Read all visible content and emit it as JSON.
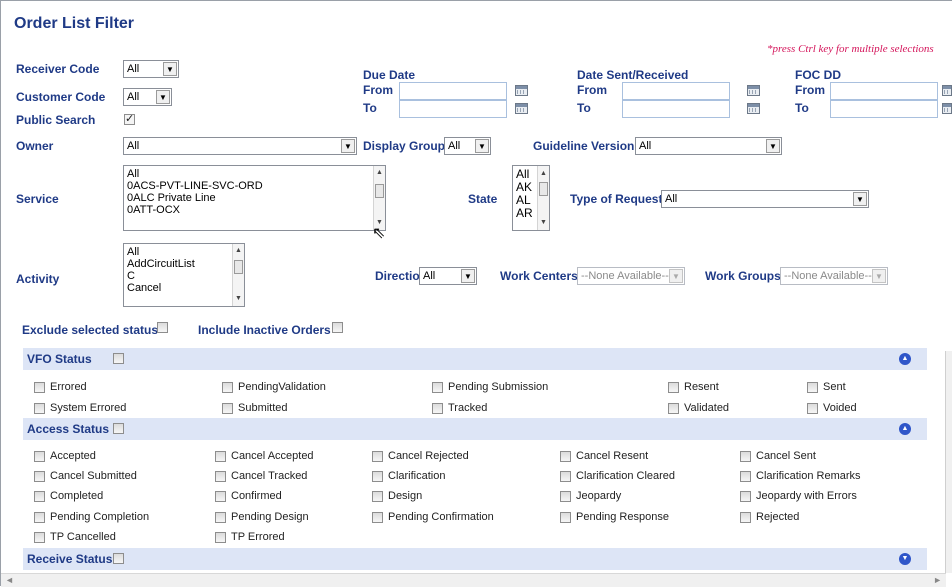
{
  "title": "Order List Filter",
  "note": "*press Ctrl key for multiple selections",
  "receiver_code": {
    "label": "Receiver Code",
    "value": "All"
  },
  "customer_code": {
    "label": "Customer Code",
    "value": "All"
  },
  "public_search": {
    "label": "Public Search",
    "checked": true
  },
  "owner": {
    "label": "Owner",
    "value": "All"
  },
  "display_group": {
    "label": "Display Group",
    "value": "All"
  },
  "guideline_version": {
    "label": "Guideline Version",
    "value": "All"
  },
  "due_date": {
    "label": "Due Date",
    "from": "From",
    "to": "To"
  },
  "date_sent": {
    "label": "Date Sent/Received",
    "from": "From",
    "to": "To"
  },
  "foc_dd": {
    "label": "FOC DD",
    "from": "From",
    "to": "To"
  },
  "service": {
    "label": "Service",
    "options": [
      "All",
      "0ACS-PVT-LINE-SVC-ORD",
      "0ALC Private Line",
      "0ATT-OCX"
    ]
  },
  "state": {
    "label": "State",
    "options": [
      "All",
      "AK",
      "AL",
      "AR"
    ]
  },
  "type_of_request": {
    "label": "Type of Request",
    "value": "All"
  },
  "activity": {
    "label": "Activity",
    "options": [
      "All",
      "AddCircuitList",
      "C",
      "Cancel"
    ]
  },
  "direction": {
    "label": "Direction",
    "value": "All"
  },
  "work_centers": {
    "label": "Work Centers",
    "value": "--None Available--"
  },
  "work_groups": {
    "label": "Work Groups",
    "value": "--None Available--"
  },
  "exclude_status": {
    "label": "Exclude selected status"
  },
  "include_inactive": {
    "label": "Include Inactive Orders"
  },
  "vfo_status": {
    "label": "VFO Status",
    "row1": [
      "Errored",
      "PendingValidation",
      "Pending Submission",
      "Resent",
      "Sent"
    ],
    "row2": [
      "System Errored",
      "Submitted",
      "Tracked",
      "Validated",
      "Voided"
    ]
  },
  "access_status": {
    "label": "Access Status",
    "rows": [
      [
        "Accepted",
        "Cancel Accepted",
        "Cancel Rejected",
        "Cancel Resent",
        "Cancel Sent"
      ],
      [
        "Cancel Submitted",
        "Cancel Tracked",
        "Clarification",
        "Clarification Cleared",
        "Clarification Remarks"
      ],
      [
        "Completed",
        "Confirmed",
        "Design",
        "Jeopardy",
        "Jeopardy with Errors"
      ],
      [
        "Pending Completion",
        "Pending Design",
        "Pending Confirmation",
        "Pending Response",
        "Rejected"
      ],
      [
        "TP Cancelled",
        "TP Errored"
      ]
    ]
  },
  "receive_status": {
    "label": "Receive Status"
  },
  "icons": {
    "collapse": "chevron-up-circle-icon",
    "expand": "chevron-down-circle-icon",
    "calendar": "calendar-icon"
  },
  "colors": {
    "label": "#1f3a86",
    "bar": "#dde5f6",
    "note": "#d4145a",
    "icon": "#2f56c9"
  }
}
